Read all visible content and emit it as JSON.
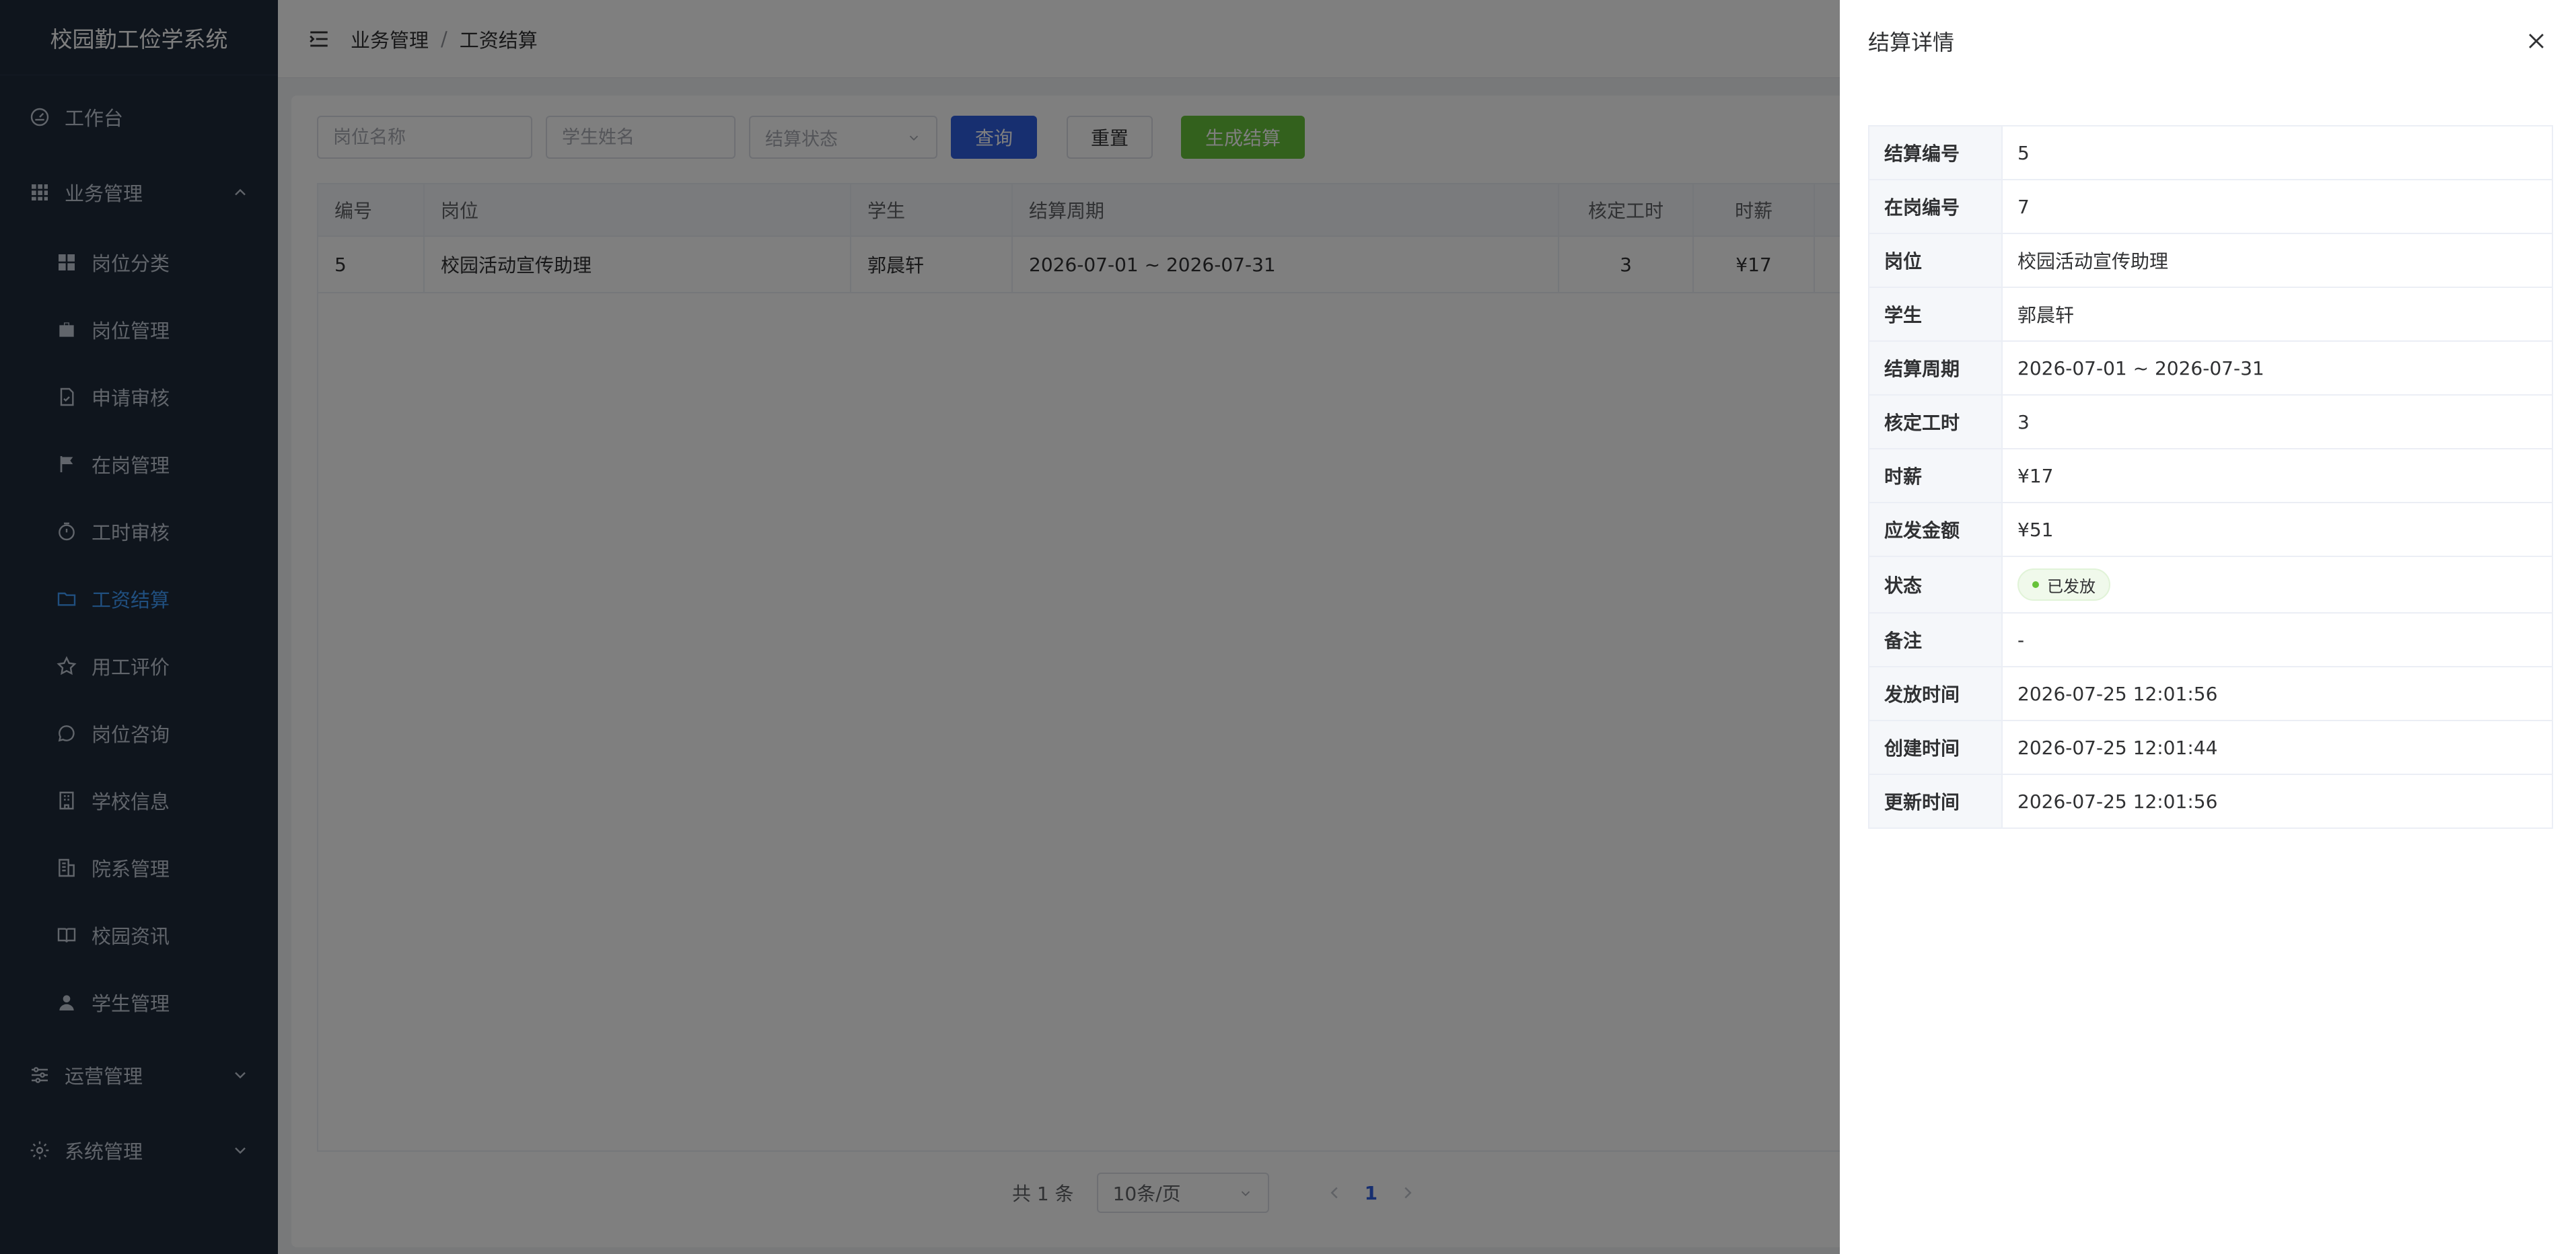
{
  "app": {
    "title": "校园勤工俭学系统"
  },
  "sidebar": {
    "workbench": "工作台",
    "business": "业务管理",
    "items": [
      {
        "label": "岗位分类",
        "icon": "grid-icon"
      },
      {
        "label": "岗位管理",
        "icon": "briefcase-icon"
      },
      {
        "label": "申请审核",
        "icon": "document-check-icon"
      },
      {
        "label": "在岗管理",
        "icon": "flag-icon"
      },
      {
        "label": "工时审核",
        "icon": "stopwatch-icon"
      },
      {
        "label": "工资结算",
        "icon": "folder-icon"
      },
      {
        "label": "用工评价",
        "icon": "star-icon"
      },
      {
        "label": "岗位咨询",
        "icon": "chat-icon"
      },
      {
        "label": "学校信息",
        "icon": "building-icon"
      },
      {
        "label": "院系管理",
        "icon": "office-icon"
      },
      {
        "label": "校园资讯",
        "icon": "book-icon"
      },
      {
        "label": "学生管理",
        "icon": "user-icon"
      }
    ],
    "operations": "运营管理",
    "system": "系统管理",
    "active_color": "#409eff"
  },
  "header": {
    "breadcrumb": [
      "业务管理",
      "工资结算"
    ],
    "separator": "/"
  },
  "filter": {
    "job_placeholder": "岗位名称",
    "student_placeholder": "学生姓名",
    "status_placeholder": "结算状态",
    "query_label": "查询",
    "reset_label": "重置",
    "generate_label": "生成结算"
  },
  "table": {
    "headers": [
      "编号",
      "岗位",
      "学生",
      "结算周期",
      "核定工时",
      "时薪"
    ],
    "rows": [
      [
        "5",
        "校园活动宣传助理",
        "郭晨轩",
        "2026-07-01 ~ 2026-07-31",
        "3",
        "¥17"
      ]
    ]
  },
  "pagination": {
    "total_text": "共 1 条",
    "page_size": "10条/页",
    "current_page": "1"
  },
  "drawer": {
    "title": "结算详情",
    "fields": [
      {
        "label": "结算编号",
        "value": "5"
      },
      {
        "label": "在岗编号",
        "value": "7"
      },
      {
        "label": "岗位",
        "value": "校园活动宣传助理"
      },
      {
        "label": "学生",
        "value": "郭晨轩"
      },
      {
        "label": "结算周期",
        "value": "2026-07-01 ~ 2026-07-31"
      },
      {
        "label": "核定工时",
        "value": "3"
      },
      {
        "label": "时薪",
        "value": "¥17"
      },
      {
        "label": "应发金额",
        "value": "¥51"
      },
      {
        "label": "状态",
        "value": "已发放"
      },
      {
        "label": "备注",
        "value": "-"
      },
      {
        "label": "发放时间",
        "value": "2026-07-25 12:01:56"
      },
      {
        "label": "创建时间",
        "value": "2026-07-25 12:01:44"
      },
      {
        "label": "更新时间",
        "value": "2026-07-25 12:01:56"
      }
    ]
  },
  "colors": {
    "sidebar_bg": "#1e2a3b",
    "primary": "#2f5ee0",
    "success": "#67c23a"
  }
}
